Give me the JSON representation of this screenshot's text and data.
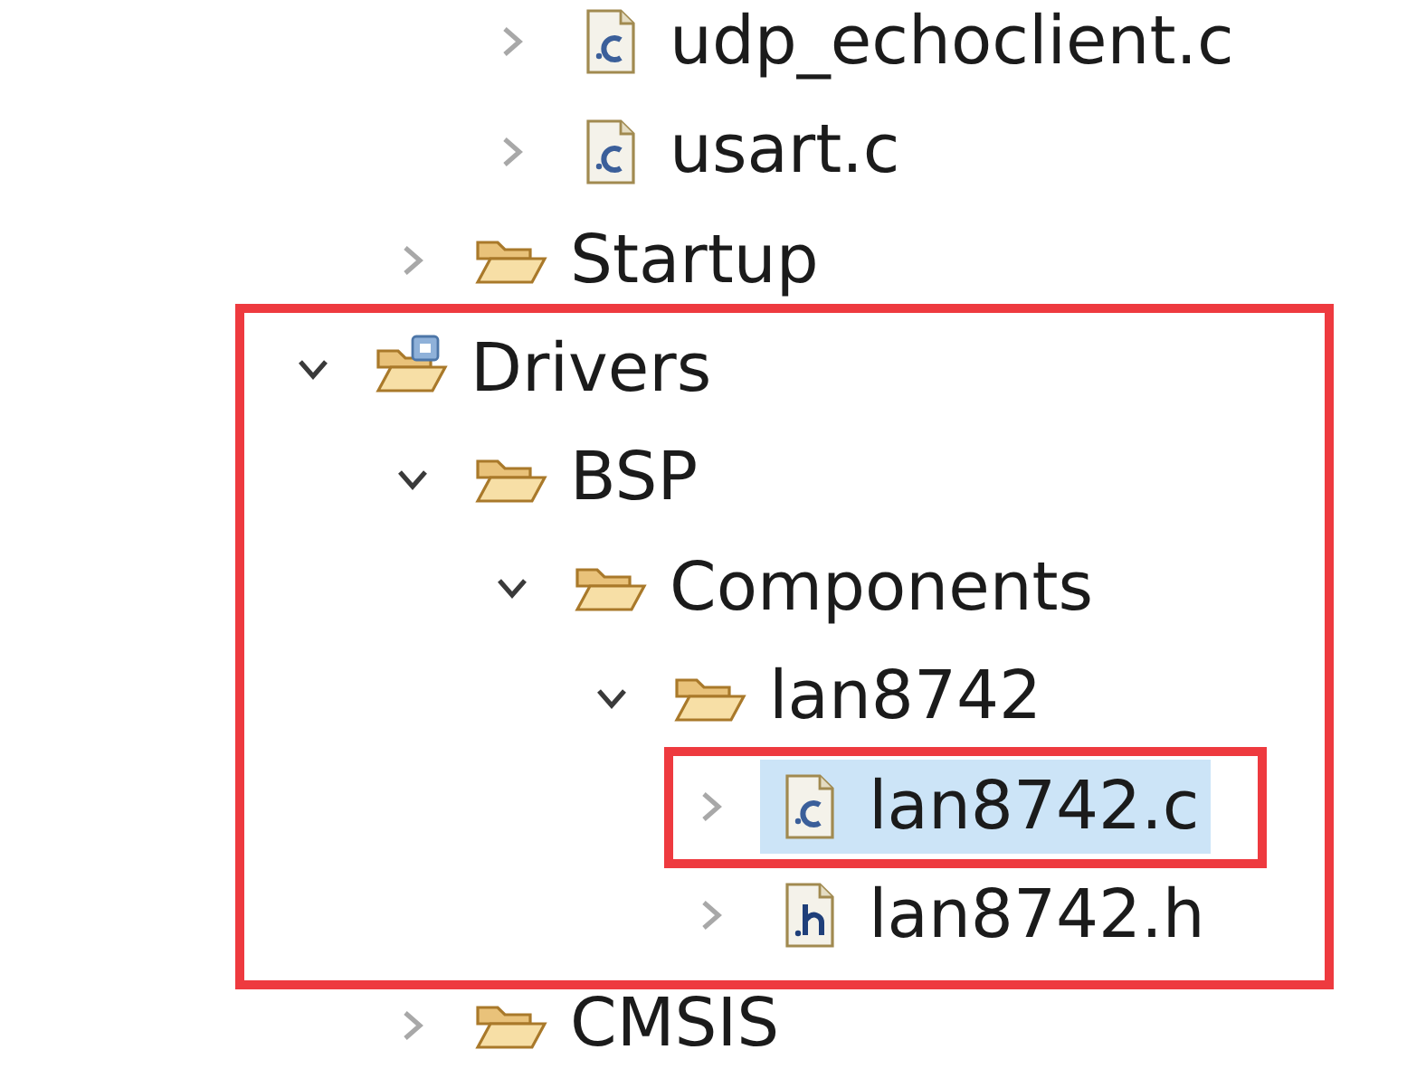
{
  "tree": [
    {
      "children": [
        {
          "children": [
            {
              "label": "udp_echoclient.c",
              "kind": "c_file",
              "expanded": false,
              "selected": false
            },
            {
              "label": "usart.c",
              "kind": "c_file",
              "expanded": false,
              "selected": false
            }
          ]
        },
        {
          "label": "Startup",
          "kind": "folder",
          "expanded": false,
          "selected": false
        }
      ]
    },
    {
      "label": "Drivers",
      "kind": "source_folder",
      "expanded": true,
      "selected": false,
      "frame_start": true,
      "children": [
        {
          "label": "BSP",
          "kind": "folder",
          "expanded": true,
          "selected": false,
          "children": [
            {
              "label": "Components",
              "kind": "folder",
              "expanded": true,
              "selected": false,
              "children": [
                {
                  "label": "lan8742",
                  "kind": "folder",
                  "expanded": true,
                  "selected": false,
                  "children": [
                    {
                      "label": "lan8742.c",
                      "kind": "c_file",
                      "expanded": false,
                      "selected": true,
                      "frame_start": true,
                      "frame_end": true
                    },
                    {
                      "label": "lan8742.h",
                      "kind": "h_file",
                      "expanded": false,
                      "selected": false,
                      "frame_end": true
                    }
                  ]
                }
              ]
            }
          ]
        },
        {
          "label": "CMSIS",
          "kind": "folder",
          "expanded": false,
          "selected": false
        }
      ]
    }
  ]
}
